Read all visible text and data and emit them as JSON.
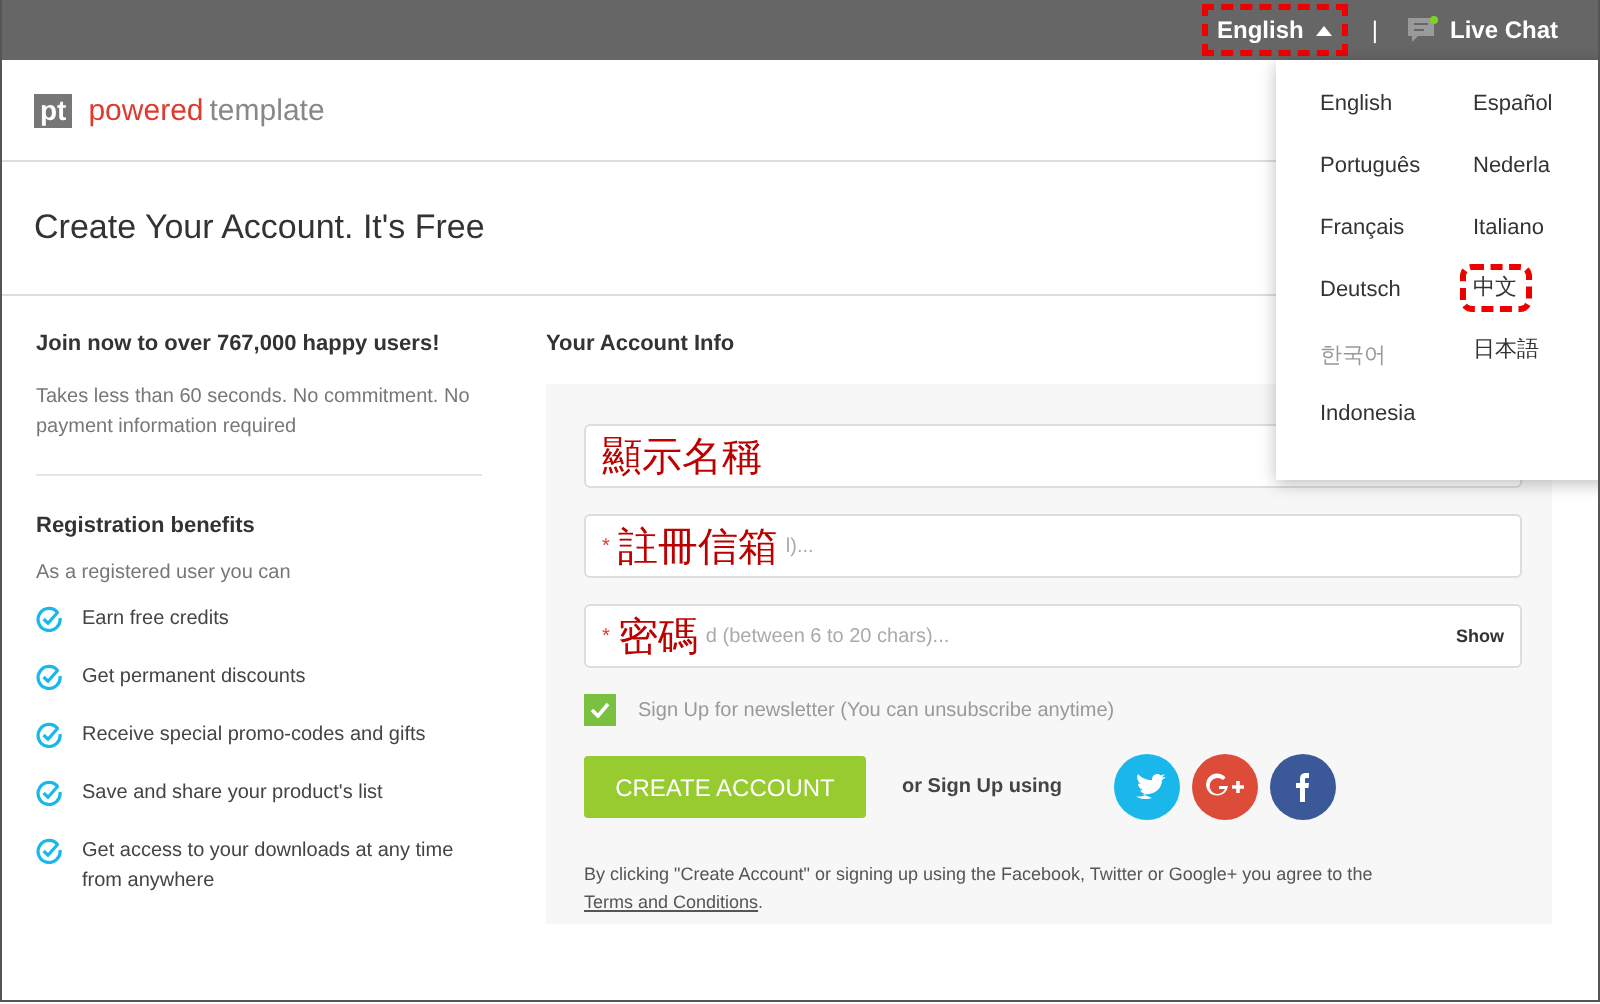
{
  "topbar": {
    "language_button": {
      "label": "English",
      "highlighted": true
    },
    "separator": "|",
    "live_chat": {
      "label": "Live Chat",
      "online": true
    }
  },
  "logo": {
    "mark": "pt",
    "brand_first": "powered",
    "brand_second": "template"
  },
  "page_title": "Create Your Account. It's Free",
  "intro": {
    "heading": "Join now to over 767,000 happy users!",
    "text": "Takes less than 60 seconds. No commitment. No payment information required"
  },
  "benefits": {
    "heading": "Registration benefits",
    "subtitle": "As a registered user you can",
    "items": [
      "Earn free credits",
      "Get permanent discounts",
      "Receive special promo-codes and gifts",
      "Save and share your product's list",
      "Get access to your downloads at any time from anywhere"
    ]
  },
  "account": {
    "heading": "Your Account Info",
    "required_symbol": "*",
    "fields": [
      {
        "required": false,
        "annotation": "顯示名稱"
      },
      {
        "required": true,
        "annotation": "註冊信箱",
        "placeholder": "l)..."
      },
      {
        "required": true,
        "annotation": "密碼",
        "placeholder": "d (between 6 to 20 chars)...",
        "action": "Show"
      }
    ],
    "newsletter": {
      "label": "Sign Up for newsletter (You can unsubscribe anytime)",
      "checked": true
    },
    "create_button": "CREATE ACCOUNT",
    "social_label": "or Sign Up using",
    "social": [
      {
        "kind": "twitter",
        "color": "#1ab7ea"
      },
      {
        "kind": "googleplus",
        "color": "#dd4b39"
      },
      {
        "kind": "facebook",
        "color": "#3b5998"
      }
    ],
    "terms": "By clicking \"Create Account\" or signing up using the Facebook, Twitter or Google+ you agree to the ",
    "terms_link": "Terms and Conditions",
    "terms_end": "."
  },
  "language_menu": {
    "columns": [
      [
        {
          "label": "English",
          "disabled": false,
          "highlighted": false
        },
        {
          "label": "Português",
          "disabled": false,
          "highlighted": false
        },
        {
          "label": "Français",
          "disabled": false,
          "highlighted": false
        },
        {
          "label": "Deutsch",
          "disabled": false,
          "highlighted": false
        },
        {
          "label": "한국어",
          "disabled": true,
          "highlighted": false
        },
        {
          "label": "Indonesia",
          "disabled": false,
          "highlighted": false
        }
      ],
      [
        {
          "label": "Español",
          "disabled": false,
          "highlighted": false
        },
        {
          "label": "Nederla",
          "disabled": false,
          "highlighted": false
        },
        {
          "label": "Italiano",
          "disabled": false,
          "highlighted": false
        },
        {
          "label": "中文",
          "disabled": false,
          "highlighted": true
        },
        {
          "label": "日本語",
          "disabled": false,
          "highlighted": false
        }
      ]
    ]
  }
}
